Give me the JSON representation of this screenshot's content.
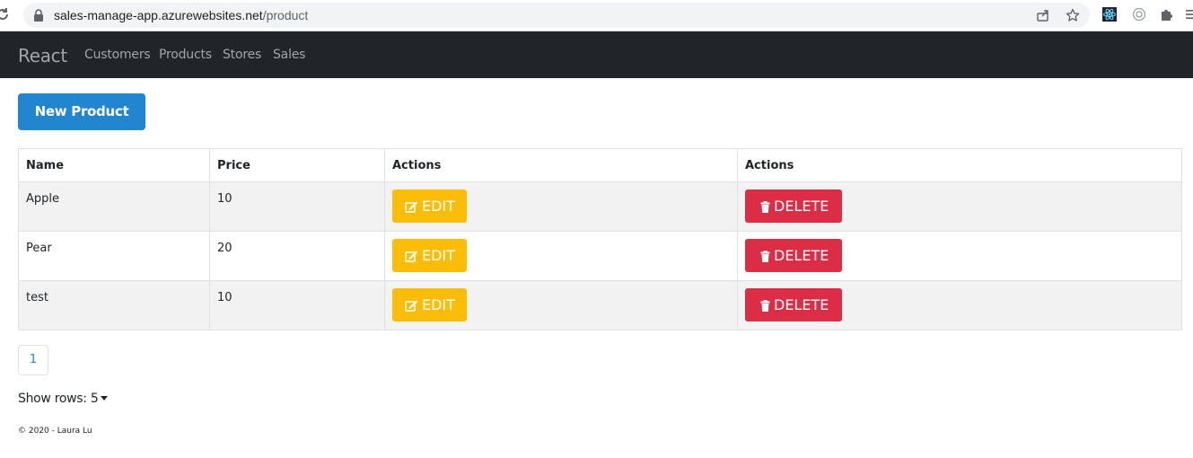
{
  "browser": {
    "url_host": "sales-manage-app.azurewebsites.net",
    "url_path": "/product",
    "icons": [
      "reload-icon",
      "lock-icon",
      "share-icon",
      "star-icon",
      "react-devtools-icon",
      "extension-icon",
      "puzzle-icon",
      "menu-icon"
    ]
  },
  "navbar": {
    "brand": "React",
    "links": [
      "Customers",
      "Products",
      "Stores",
      "Sales"
    ]
  },
  "toolbar": {
    "new_label": "New Product"
  },
  "table": {
    "headers": [
      "Name",
      "Price",
      "Actions",
      "Actions"
    ],
    "rows": [
      {
        "name": "Apple",
        "price": "10",
        "edit": "EDIT",
        "delete": "DELETE"
      },
      {
        "name": "Pear",
        "price": "20",
        "edit": "EDIT",
        "delete": "DELETE"
      },
      {
        "name": "test",
        "price": "10",
        "edit": "EDIT",
        "delete": "DELETE"
      }
    ]
  },
  "pagination": {
    "current_page": "1"
  },
  "show_rows": {
    "label": "Show rows: 5"
  },
  "footer": {
    "text": "© 2020 - Laura Lu"
  },
  "colors": {
    "navbar_bg": "#212529",
    "primary": "#2185d0",
    "edit": "#fbbd08",
    "delete": "#db2e46",
    "stripe": "#f2f2f2"
  }
}
